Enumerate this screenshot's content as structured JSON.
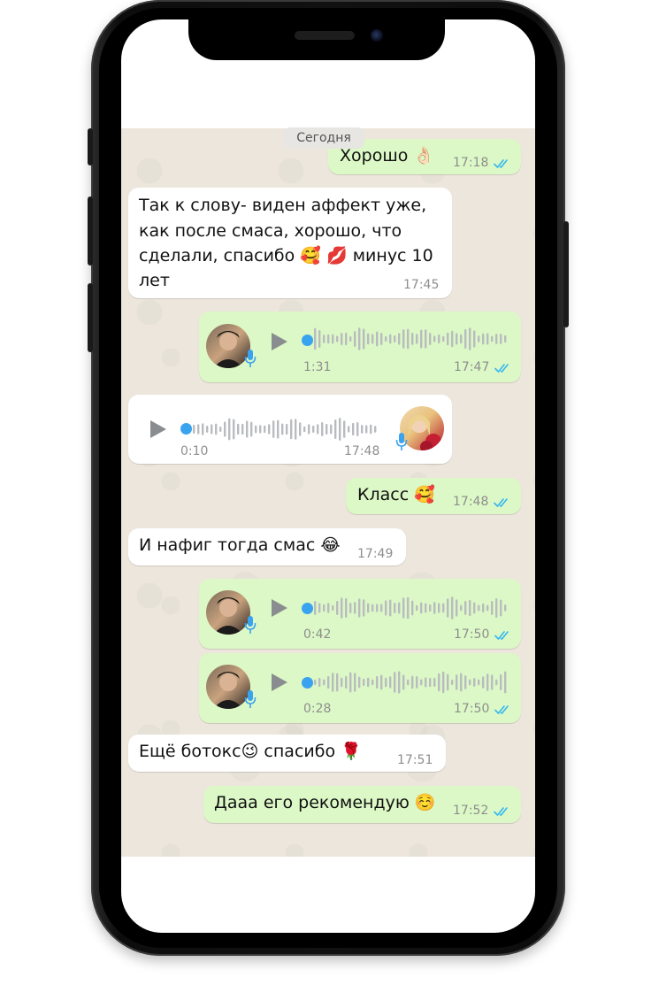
{
  "date_divider": "Сегодня",
  "messages": [
    {
      "type": "text",
      "direction": "out",
      "text": "Хорошо 👌🏻",
      "time": "17:18"
    },
    {
      "type": "text",
      "direction": "in",
      "lines": [
        "Так к слову- виден аффект уже,",
        "как после смаса, хорошо, что",
        "сделали, спасибо 🥰 💋 минус 10",
        "лет"
      ],
      "time": "17:45"
    },
    {
      "type": "voice",
      "direction": "out",
      "duration": "1:31",
      "time": "17:47"
    },
    {
      "type": "voice",
      "direction": "in",
      "duration": "0:10",
      "time": "17:48"
    },
    {
      "type": "text",
      "direction": "out",
      "text": "Класс 🥰",
      "time": "17:48"
    },
    {
      "type": "text",
      "direction": "in",
      "text": "И нафиг тогда смас 😂",
      "time": "17:49"
    },
    {
      "type": "voice",
      "direction": "out",
      "duration": "0:42",
      "time": "17:50"
    },
    {
      "type": "voice",
      "direction": "out",
      "duration": "0:28",
      "time": "17:50"
    },
    {
      "type": "text",
      "direction": "in",
      "text": "Ещё ботокс😉 спасибо 🌹",
      "time": "17:51"
    },
    {
      "type": "text",
      "direction": "out",
      "text": "Дааа его рекомендую ☺️",
      "time": "17:52"
    }
  ],
  "colors": {
    "outgoing": "#dcf8c6",
    "incoming": "#ffffff",
    "read_ticks": "#34b7f1",
    "voice_dot": "#3aa3f0"
  },
  "icons": {
    "play": "play-icon",
    "mic": "microphone-icon",
    "read": "double-check-icon"
  }
}
